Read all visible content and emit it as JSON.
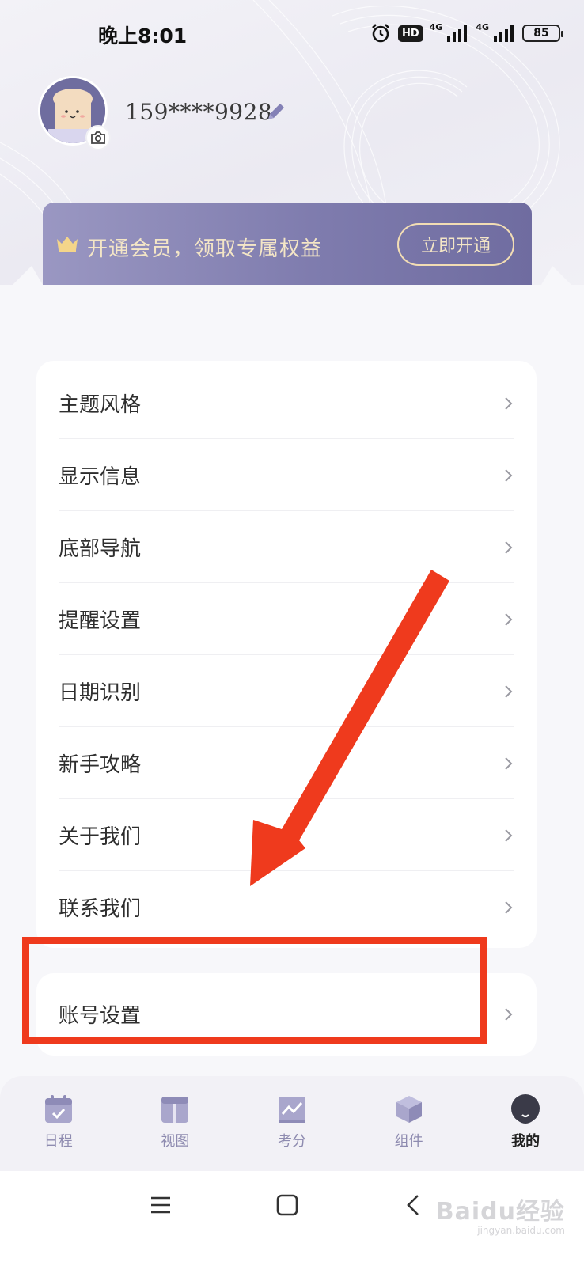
{
  "status_bar": {
    "time": "晚上8:01",
    "hd": "HD",
    "network_1": "4G",
    "network_2": "4G",
    "battery": "85"
  },
  "profile": {
    "phone": "159****9928"
  },
  "vip_banner": {
    "text": "开通会员，领取专属权益",
    "button": "立即开通"
  },
  "menu": {
    "items": [
      {
        "label": "主题风格"
      },
      {
        "label": "显示信息"
      },
      {
        "label": "底部导航"
      },
      {
        "label": "提醒设置"
      },
      {
        "label": "日期识别"
      },
      {
        "label": "新手攻略"
      },
      {
        "label": "关于我们"
      },
      {
        "label": "联系我们"
      }
    ],
    "account": {
      "label": "账号设置"
    }
  },
  "tab_bar": {
    "tabs": [
      {
        "label": "日程",
        "icon": "calendar-icon"
      },
      {
        "label": "视图",
        "icon": "layout-icon"
      },
      {
        "label": "考分",
        "icon": "trend-chart-icon"
      },
      {
        "label": "组件",
        "icon": "cube-icon"
      },
      {
        "label": "我的",
        "icon": "profile-icon",
        "active": true
      }
    ]
  },
  "watermark": {
    "main": "Baidu经验",
    "sub": "jingyan.baidu.com"
  },
  "colors": {
    "accent": "#7f7cae",
    "vip_gold": "#f4e6c6",
    "annotation_red": "#ef3a1d",
    "tab_inactive": "#8e8bb0"
  }
}
